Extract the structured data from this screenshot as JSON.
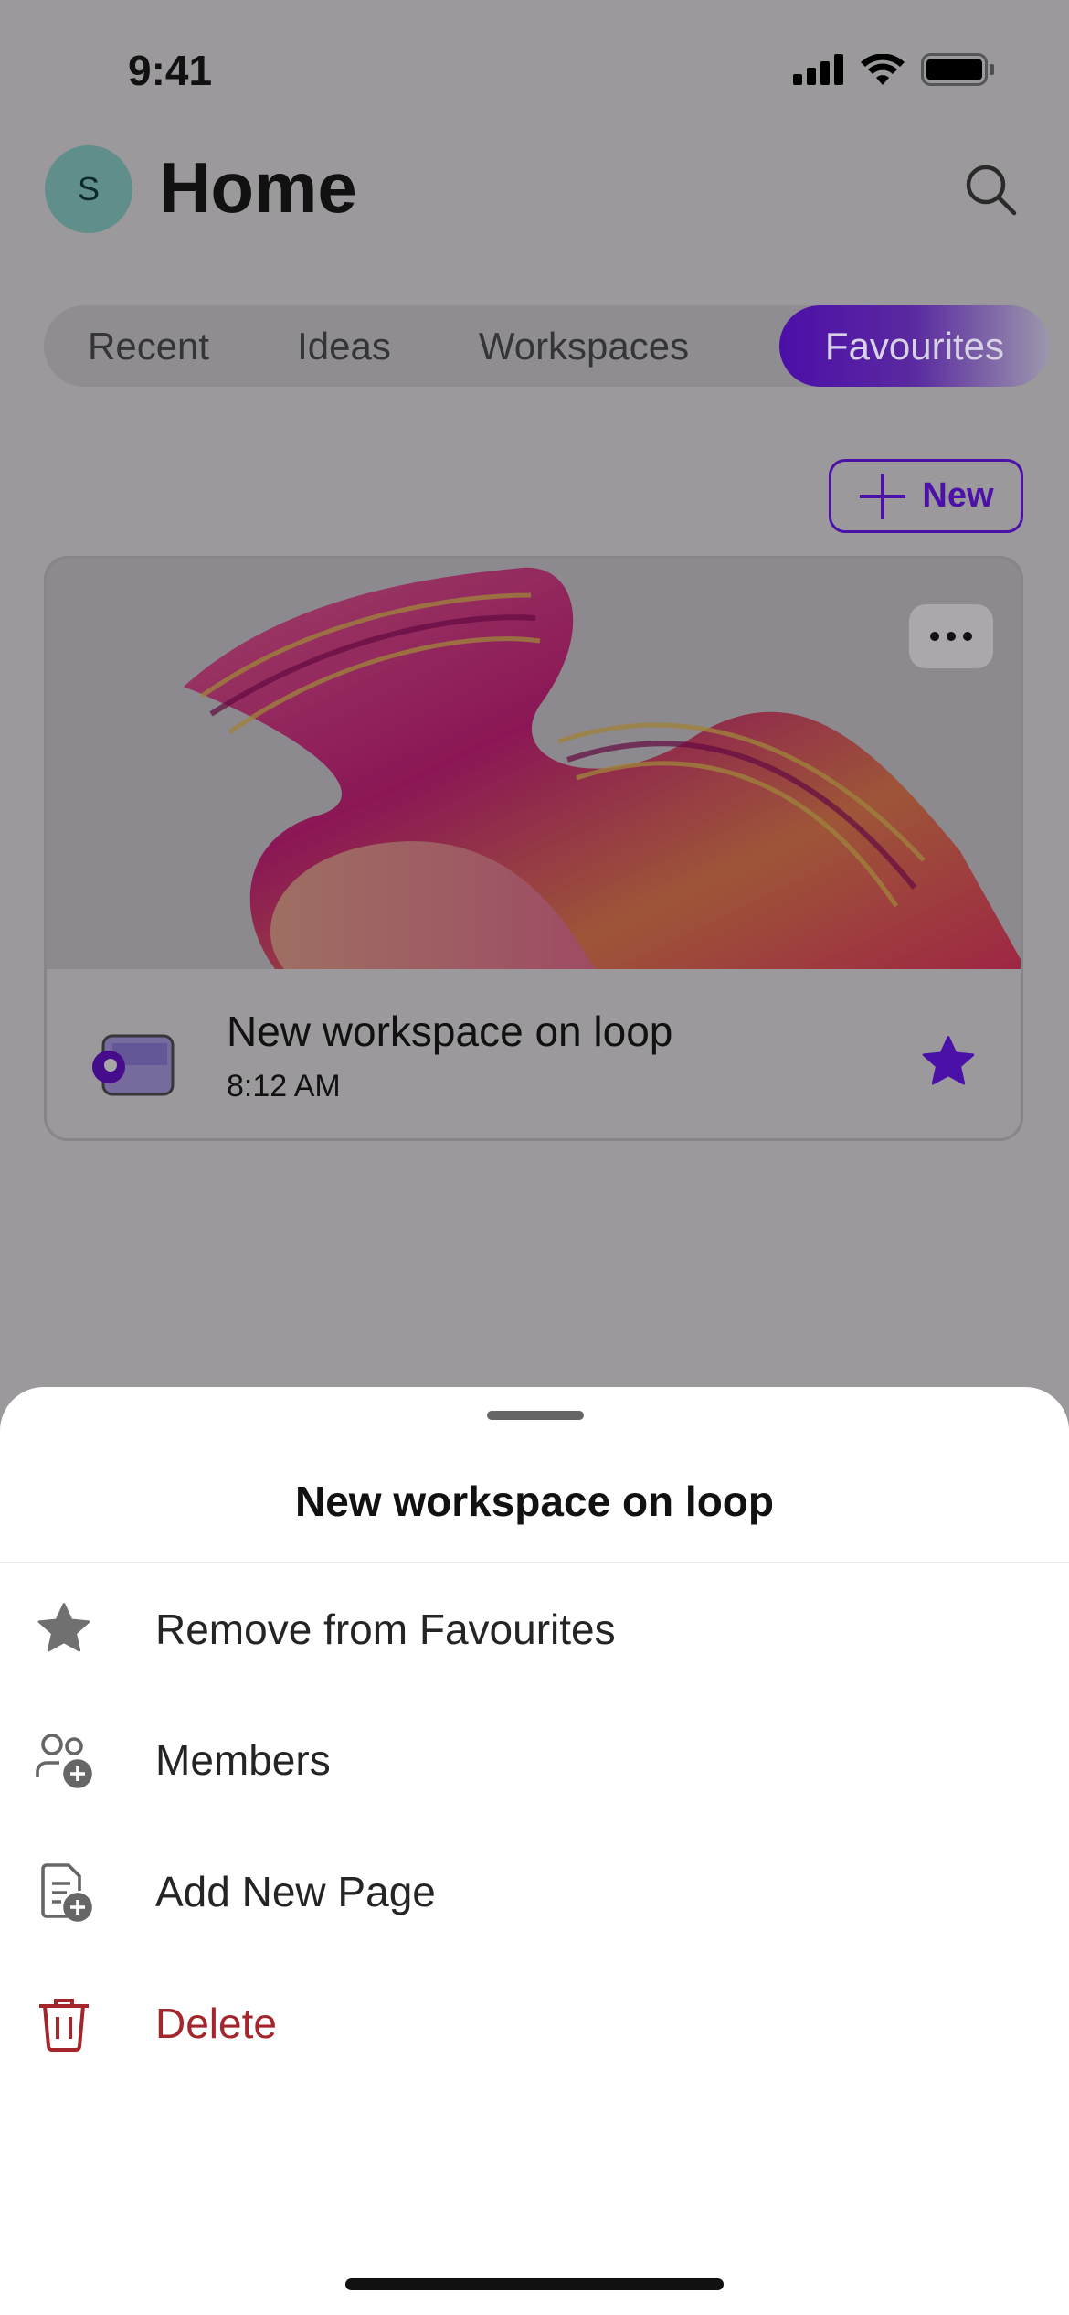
{
  "status_bar": {
    "time": "9:41"
  },
  "header": {
    "avatar_initial": "S",
    "title": "Home"
  },
  "tabs": [
    {
      "label": "Recent"
    },
    {
      "label": "Ideas"
    },
    {
      "label": "Workspaces"
    },
    {
      "label": "Favourites",
      "active": true
    }
  ],
  "new_button": {
    "label": "New"
  },
  "card": {
    "title": "New workspace on loop",
    "time": "8:12 AM",
    "favourited": true
  },
  "sheet": {
    "title": "New workspace on loop",
    "items": [
      {
        "label": "Remove from Favourites",
        "icon": "star-icon"
      },
      {
        "label": "Members",
        "icon": "members-add-icon"
      },
      {
        "label": "Add New Page",
        "icon": "page-add-icon"
      },
      {
        "label": "Delete",
        "icon": "trash-icon",
        "color": "#a4262c"
      }
    ]
  },
  "colors": {
    "accent": "#6a12d8",
    "danger": "#a4262c"
  }
}
